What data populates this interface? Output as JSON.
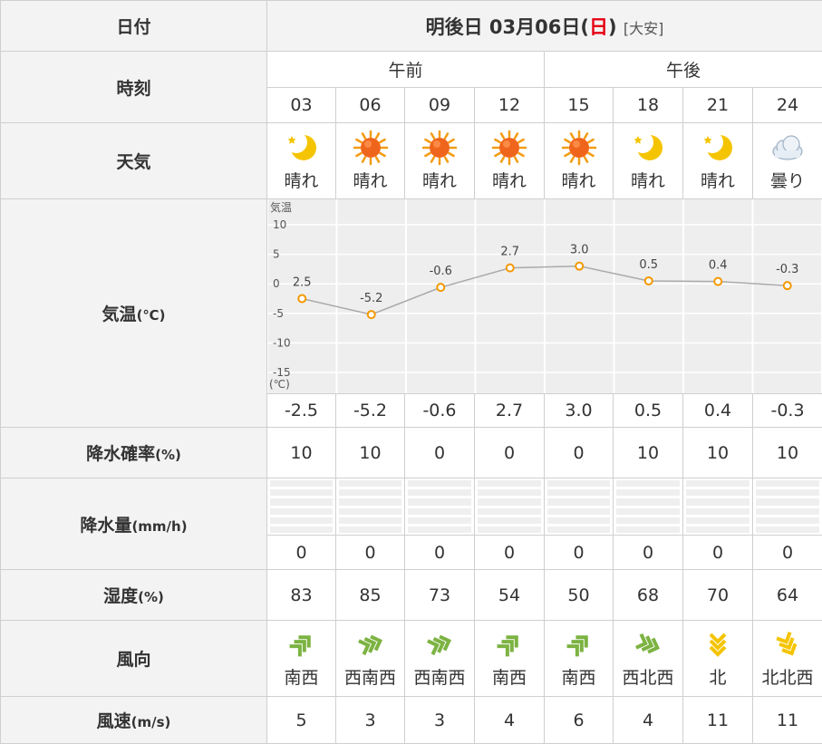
{
  "header": {
    "date_label": "日付",
    "title_prefix": "明後日 03月06日(",
    "title_day": "日",
    "title_suffix": ")",
    "title_rokuyo": "[大安]"
  },
  "rows": {
    "time": "時刻",
    "weather": "天気",
    "temp": "気温",
    "temp_unit": "(℃)",
    "precip_prob": "降水確率",
    "precip_prob_unit": "(%)",
    "precip": "降水量",
    "precip_unit": "(mm/h)",
    "humidity": "湿度",
    "humidity_unit": "(%)",
    "wind_dir": "風向",
    "wind_speed": "風速",
    "wind_speed_unit": "(m/s)"
  },
  "periods": {
    "am": "午前",
    "pm": "午後"
  },
  "hours": [
    "03",
    "06",
    "09",
    "12",
    "15",
    "18",
    "21",
    "24"
  ],
  "weather": [
    {
      "icon": "moon-icon",
      "label": "晴れ"
    },
    {
      "icon": "sun-icon",
      "label": "晴れ"
    },
    {
      "icon": "sun-icon",
      "label": "晴れ"
    },
    {
      "icon": "sun-icon",
      "label": "晴れ"
    },
    {
      "icon": "sun-icon",
      "label": "晴れ"
    },
    {
      "icon": "moon-icon",
      "label": "晴れ"
    },
    {
      "icon": "moon-icon",
      "label": "晴れ"
    },
    {
      "icon": "cloud-icon",
      "label": "曇り"
    }
  ],
  "temps_text": [
    "-2.5",
    "-5.2",
    "-0.6",
    "2.7",
    "3.0",
    "0.5",
    "0.4",
    "-0.3"
  ],
  "precip_prob": [
    "10",
    "10",
    "0",
    "0",
    "0",
    "10",
    "10",
    "10"
  ],
  "precip": [
    "0",
    "0",
    "0",
    "0",
    "0",
    "0",
    "0",
    "0"
  ],
  "humidity": [
    "83",
    "85",
    "73",
    "54",
    "50",
    "68",
    "70",
    "64"
  ],
  "wind_dir": [
    {
      "label": "南西",
      "icon": "wind-arrow-icon",
      "rot": -45,
      "color": "#7cb342"
    },
    {
      "label": "西南西",
      "icon": "wind-arrow-icon",
      "rot": -20,
      "color": "#7cb342"
    },
    {
      "label": "西南西",
      "icon": "wind-arrow-icon",
      "rot": -20,
      "color": "#7cb342"
    },
    {
      "label": "南西",
      "icon": "wind-arrow-icon",
      "rot": -45,
      "color": "#7cb342"
    },
    {
      "label": "南西",
      "icon": "wind-arrow-icon",
      "rot": -45,
      "color": "#7cb342"
    },
    {
      "label": "西北西",
      "icon": "wind-arrow-icon",
      "rot": 20,
      "color": "#7cb342"
    },
    {
      "label": "北",
      "icon": "wind-arrow-icon",
      "rot": 90,
      "color": "#f5c400"
    },
    {
      "label": "北北西",
      "icon": "wind-arrow-icon",
      "rot": 65,
      "color": "#f5c400"
    }
  ],
  "wind_speed": [
    "5",
    "3",
    "3",
    "4",
    "6",
    "4",
    "11",
    "11"
  ],
  "chart_data": {
    "type": "line",
    "x": [
      "03",
      "06",
      "09",
      "12",
      "15",
      "18",
      "21",
      "24"
    ],
    "series": [
      {
        "values": [
          -2.5,
          -5.2,
          -0.6,
          2.7,
          3.0,
          0.5,
          0.4,
          -0.3
        ]
      }
    ],
    "title": "気温",
    "ylabel": "(℃)",
    "yticks": [
      "10",
      "5",
      "0",
      "-5",
      "-10",
      "-15"
    ],
    "ylim": [
      -17,
      12
    ],
    "labels": [
      "2.5",
      "-5.2",
      "-0.6",
      "2.7",
      "3.0",
      "0.5",
      "0.4",
      "-0.3"
    ],
    "line_color": "#aaaaaa",
    "marker_color": "#f39800",
    "grid": true
  },
  "colors": {
    "header_bg": "#f3f3f3",
    "border": "#cfcfcf",
    "sunday": "#e60012"
  }
}
